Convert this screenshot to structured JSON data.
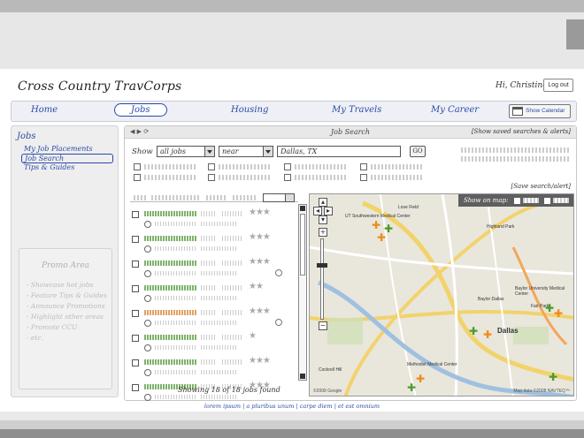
{
  "app": {
    "title": "Cross Country TravCorps",
    "greeting": "Hi, Christine",
    "logout": "Log out"
  },
  "nav": {
    "items": [
      "Home",
      "Jobs",
      "Housing",
      "My Travels",
      "My Career"
    ],
    "active": "Jobs",
    "show_calendar": "Show Calendar"
  },
  "sidebar": {
    "heading": "Jobs",
    "links": [
      "My Job Placements",
      "Job Search",
      "Tips & Guides"
    ],
    "active": "Job Search",
    "promo": {
      "title": "Promo Area",
      "items": [
        "- Showcase hot jobs",
        "- Feature Tips & Guides",
        "- Announce Promotions",
        "- Highlight other areas",
        "- Promote CCU",
        "- etc."
      ]
    }
  },
  "search": {
    "header_nav": "◀ ▶ ⟳",
    "title": "Job Search",
    "saved_link": "[Show saved searches & alerts]",
    "show_label": "Show",
    "type_value": "all jobs",
    "proximity_value": "near",
    "location_value": "Dallas, TX",
    "go_label": "GO",
    "save_label": "[Save search/alert]",
    "showing": "Showing 18 of 18 jobs found"
  },
  "results": {
    "rows": [
      {
        "stars": "★★★",
        "color": "green",
        "extra": false
      },
      {
        "stars": "★★★",
        "color": "green",
        "extra": false
      },
      {
        "stars": "★★★",
        "color": "green",
        "extra": true
      },
      {
        "stars": "★★",
        "color": "green",
        "extra": false
      },
      {
        "stars": "★★★",
        "color": "orange",
        "extra": true
      },
      {
        "stars": "★",
        "color": "green",
        "extra": false
      },
      {
        "stars": "★★★",
        "color": "green",
        "extra": false
      },
      {
        "stars": "★★★",
        "color": "green",
        "extra": false
      }
    ]
  },
  "map": {
    "show_on_map": "Show on map:",
    "labels": [
      "UT Southwestern Medical Center",
      "Love Field",
      "Dallas",
      "Baylor University Medical Center",
      "Methodist Medical Center",
      "Fair Park",
      "Baylor Dallas",
      "Cockrell Hill",
      "Highland Park"
    ],
    "copyright": "©2008 Google",
    "mapdata": "Map data ©2008 NAVTEQ™"
  },
  "footer": {
    "links": [
      "lorem ipsum",
      "a pluribus unum",
      "carpe diem",
      "et est omnium"
    ],
    "separator": " | "
  },
  "colors": {
    "link": "#2b4aa8",
    "star": "#aaaaaa",
    "bar_green": "#7fb26b",
    "bar_orange": "#e2a266"
  }
}
